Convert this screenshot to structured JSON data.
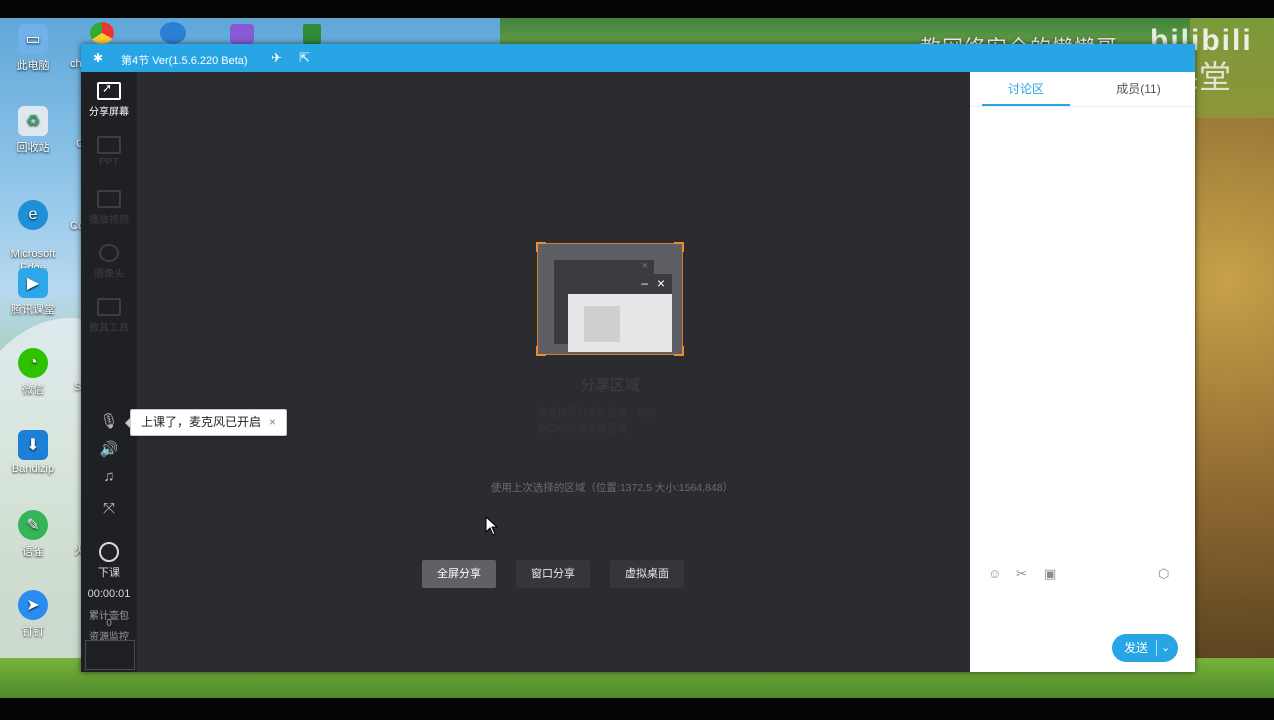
{
  "desktop": {
    "icons": [
      {
        "label": "此电脑",
        "icon": "computer-icon",
        "color": "#6fb1e8"
      },
      {
        "label": "回收站",
        "icon": "recycle-bin-icon",
        "color": "#dfe8ee"
      },
      {
        "label": "Microsoft\nEdge",
        "icon": "edge-icon",
        "color": "#1f8fd6"
      },
      {
        "label": "腾讯课堂",
        "icon": "tencent-classroom-icon",
        "color": "#2ea7ea"
      },
      {
        "label": "微信",
        "icon": "wechat-icon",
        "color": "#2dc100"
      },
      {
        "label": "Bandizip",
        "icon": "bandizip-icon",
        "color": "#1d7fd6"
      },
      {
        "label": "语雀",
        "icon": "yuque-icon",
        "color": "#35b45a"
      },
      {
        "label": "钉钉",
        "icon": "dingtalk-icon",
        "color": "#2a8cf0"
      }
    ],
    "partial_labels": [
      "ch",
      "C",
      "Co",
      "S",
      "火"
    ]
  },
  "watermark": {
    "text": "教网络安全的懒懒哥",
    "logo": "bilibili",
    "app_mark": "腾讯课堂"
  },
  "titlebar": {
    "title": "第4节 Ver(1.5.6.220 Beta)",
    "accent": "#27a5e4"
  },
  "sidebar": {
    "share_screen": "分享屏幕",
    "ppt": "PPT",
    "play_video": "播放视频",
    "camera": "摄像头",
    "teaching_tools": "教具工具",
    "end_class": "下课",
    "timer": "00:00:01",
    "gifts_label": "累计壶包",
    "gifts_count": "0",
    "resource_monitor": "资源监控"
  },
  "tooltip": {
    "text": "上课了，麦克风已开启"
  },
  "share_area": {
    "title": "分享区域",
    "desc_line1": "请选择要分享的区域，可在",
    "desc_line2": "窗口中拖拽调整区域",
    "last_used": "使用上次选择的区域（位置:1372,5 大小:1564,848）",
    "btn_fullscreen": "全屏分享",
    "btn_window": "窗口分享",
    "btn_virtual": "虚拟桌面"
  },
  "panel": {
    "tab_discussion": "讨论区",
    "tab_members": "成员(11)",
    "send": "发送"
  }
}
